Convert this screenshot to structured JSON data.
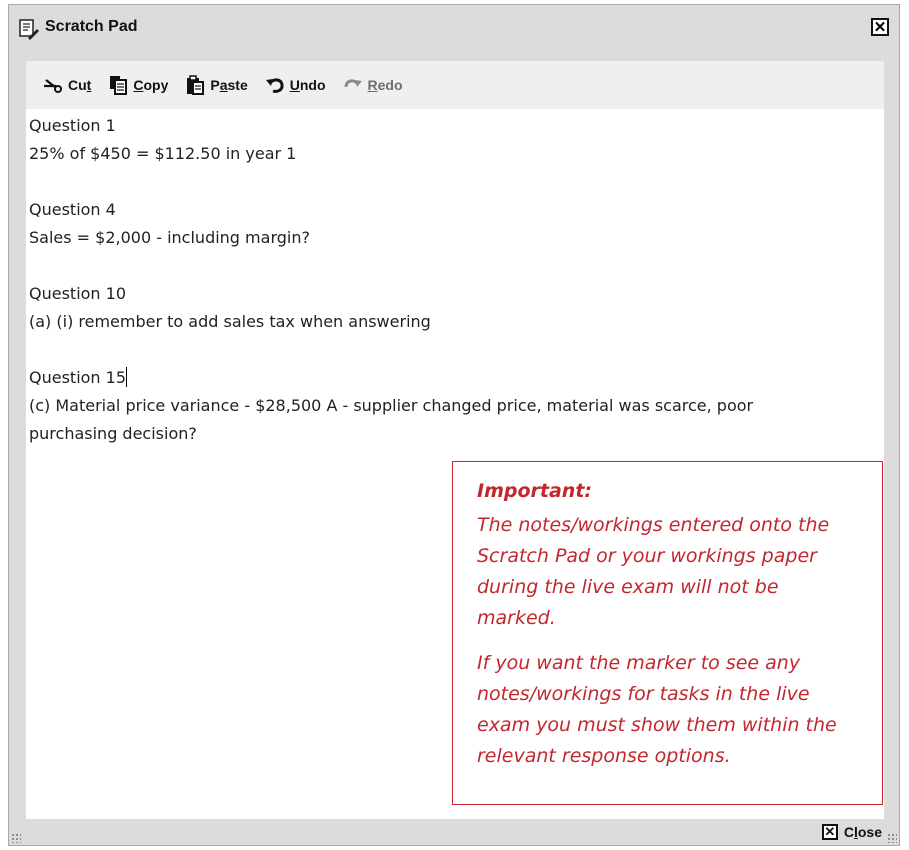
{
  "window": {
    "title": "Scratch Pad",
    "close_icon": "close-x-icon"
  },
  "toolbar": {
    "cut_label_pre": "Cu",
    "cut_label_u": "t",
    "copy_label_u": "C",
    "copy_label_post": "opy",
    "paste_label_pre": "P",
    "paste_label_u": "a",
    "paste_label_post": "ste",
    "undo_label_u": "U",
    "undo_label_post": "ndo",
    "redo_label_u": "R",
    "redo_label_post": "edo"
  },
  "notes": {
    "lines": [
      "Question 1",
      "25% of $450 = $112.50 in year 1",
      "",
      "Question 4",
      "Sales = $2,000 - including margin?",
      "",
      "Question 10",
      "(a) (i) remember to add sales tax when answering",
      "",
      "Question 15",
      "(c) Material price variance  - $28,500 A - supplier changed price, material was scarce, poor purchasing decision?"
    ]
  },
  "important_box": {
    "heading": "Important:",
    "para1": "The notes/workings entered onto the Scratch Pad or your workings paper during the live exam will not be marked.",
    "para2": "If you want the marker to see any notes/workings for tasks in the live exam you must show them within the relevant response options."
  },
  "footer": {
    "close_label_pre": "C",
    "close_label_u": "l",
    "close_label_post": "ose"
  },
  "colors": {
    "accent_red": "#c3272e",
    "chrome_gray": "#dcdcdc",
    "toolbar_gray": "#efefef"
  }
}
